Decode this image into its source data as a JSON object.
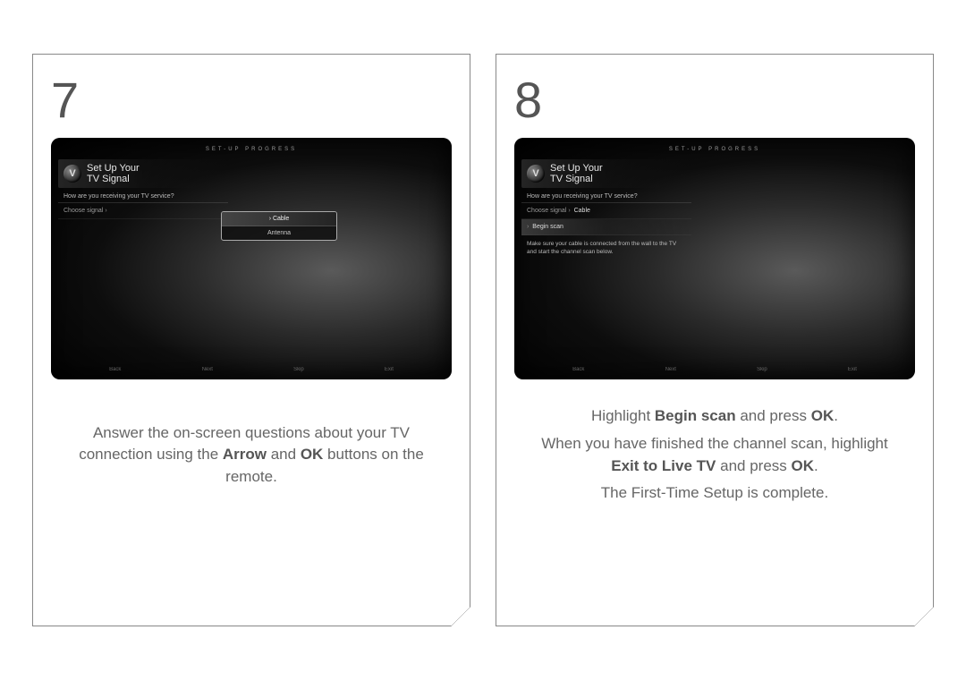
{
  "step7": {
    "number": "7",
    "tv": {
      "progress_label": "SET-UP PROGRESS",
      "title_line1": "Set Up Your",
      "title_line2": "TV Signal",
      "question": "How are you receiving your TV service?",
      "row_label": "Choose signal",
      "popup_option1": "Cable",
      "popup_option2": "Antenna",
      "footer": {
        "back": "Back",
        "next": "Next",
        "skip": "Skip",
        "exit": "Exit"
      }
    },
    "instr": {
      "t1": "Answer the on-screen questions about your TV connection using the ",
      "b1": "Arrow",
      "t2": " and ",
      "b2": "OK",
      "t3": " buttons on the remote."
    }
  },
  "step8": {
    "number": "8",
    "tv": {
      "progress_label": "SET-UP PROGRESS",
      "title_line1": "Set Up Your",
      "title_line2": "TV Signal",
      "question": "How are you receiving your TV service?",
      "breadcrumb_a": "Choose signal",
      "breadcrumb_b": "Cable",
      "row_begin": "Begin scan",
      "note": "Make sure your cable is connected from the wall to the TV and start the channel scan below.",
      "footer": {
        "back": "Back",
        "next": "Next",
        "skip": "Skip",
        "exit": "Exit"
      }
    },
    "instr": {
      "line1_a": "Highlight ",
      "line1_b": "Begin scan",
      "line1_c": " and press ",
      "line1_d": "OK",
      "line1_e": ".",
      "line2_a": "When you have finished the channel scan, highlight ",
      "line2_b": "Exit to Live TV",
      "line2_c": " and press ",
      "line2_d": "OK",
      "line2_e": ".",
      "line3": "The First-Time Setup is complete."
    }
  }
}
